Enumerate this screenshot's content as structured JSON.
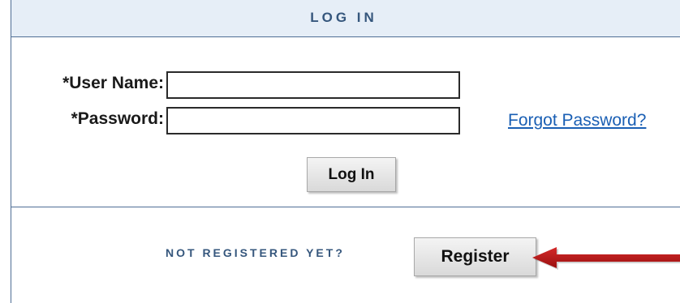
{
  "header": {
    "title": "LOG IN"
  },
  "form": {
    "username_label": "*User Name:",
    "username_value": "",
    "password_label": "*Password:",
    "password_value": "",
    "forgot_password_link": "Forgot Password?",
    "login_button": "Log In"
  },
  "registration": {
    "prompt": "NOT REGISTERED YET?",
    "register_button": "Register"
  },
  "colors": {
    "header_bg": "#e6eef7",
    "border": "#4f6e95",
    "heading_text": "#36577d",
    "link": "#1a5fb4",
    "arrow": "#b01414"
  },
  "icons": {
    "callout_arrow": "left-arrow-icon"
  }
}
